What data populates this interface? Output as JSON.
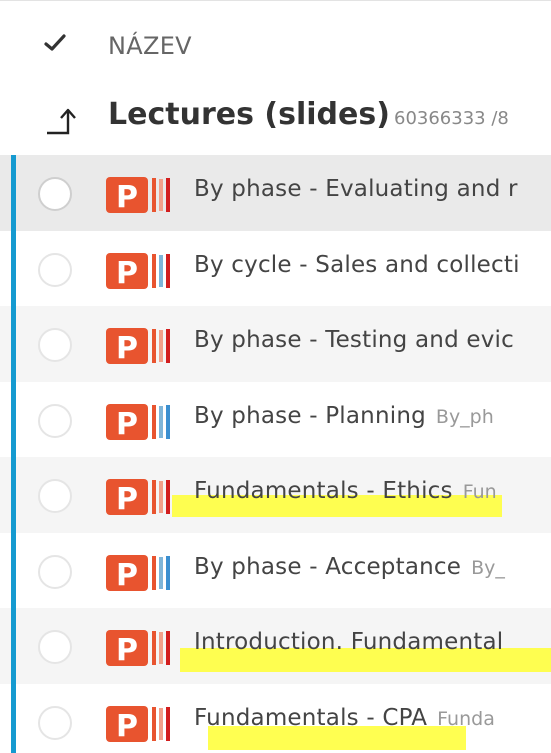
{
  "header": {
    "column_label": "NÁZEV"
  },
  "folder": {
    "title": "Lectures (slides)",
    "meta": "60366333 /8"
  },
  "files": [
    {
      "name": "By phase - Evaluating and r",
      "sub": "",
      "state": "selected"
    },
    {
      "name": "By cycle - Sales and collecti",
      "sub": "",
      "state": ""
    },
    {
      "name": "By phase - Testing and evic",
      "sub": "",
      "state": "alt"
    },
    {
      "name": "By phase - Planning",
      "sub": "By_ph",
      "state": ""
    },
    {
      "name": "Fundamentals - Ethics",
      "sub": "Fun",
      "state": "alt"
    },
    {
      "name": "By phase - Acceptance",
      "sub": "By_",
      "state": ""
    },
    {
      "name": "Introduction. Fundamental",
      "sub": "",
      "state": "alt"
    },
    {
      "name": "Fundamentals - CPA",
      "sub": "Funda",
      "state": ""
    }
  ],
  "icons": {
    "header_check": "check-icon",
    "folder_up": "level-up-icon",
    "file_type": "powerpoint-file-icon"
  },
  "colors": {
    "accent_bar": "#159ad0",
    "ppt_orange": "#e8542f",
    "ppt_edge_red": "#d21e1e",
    "highlight": "#ffff33"
  }
}
